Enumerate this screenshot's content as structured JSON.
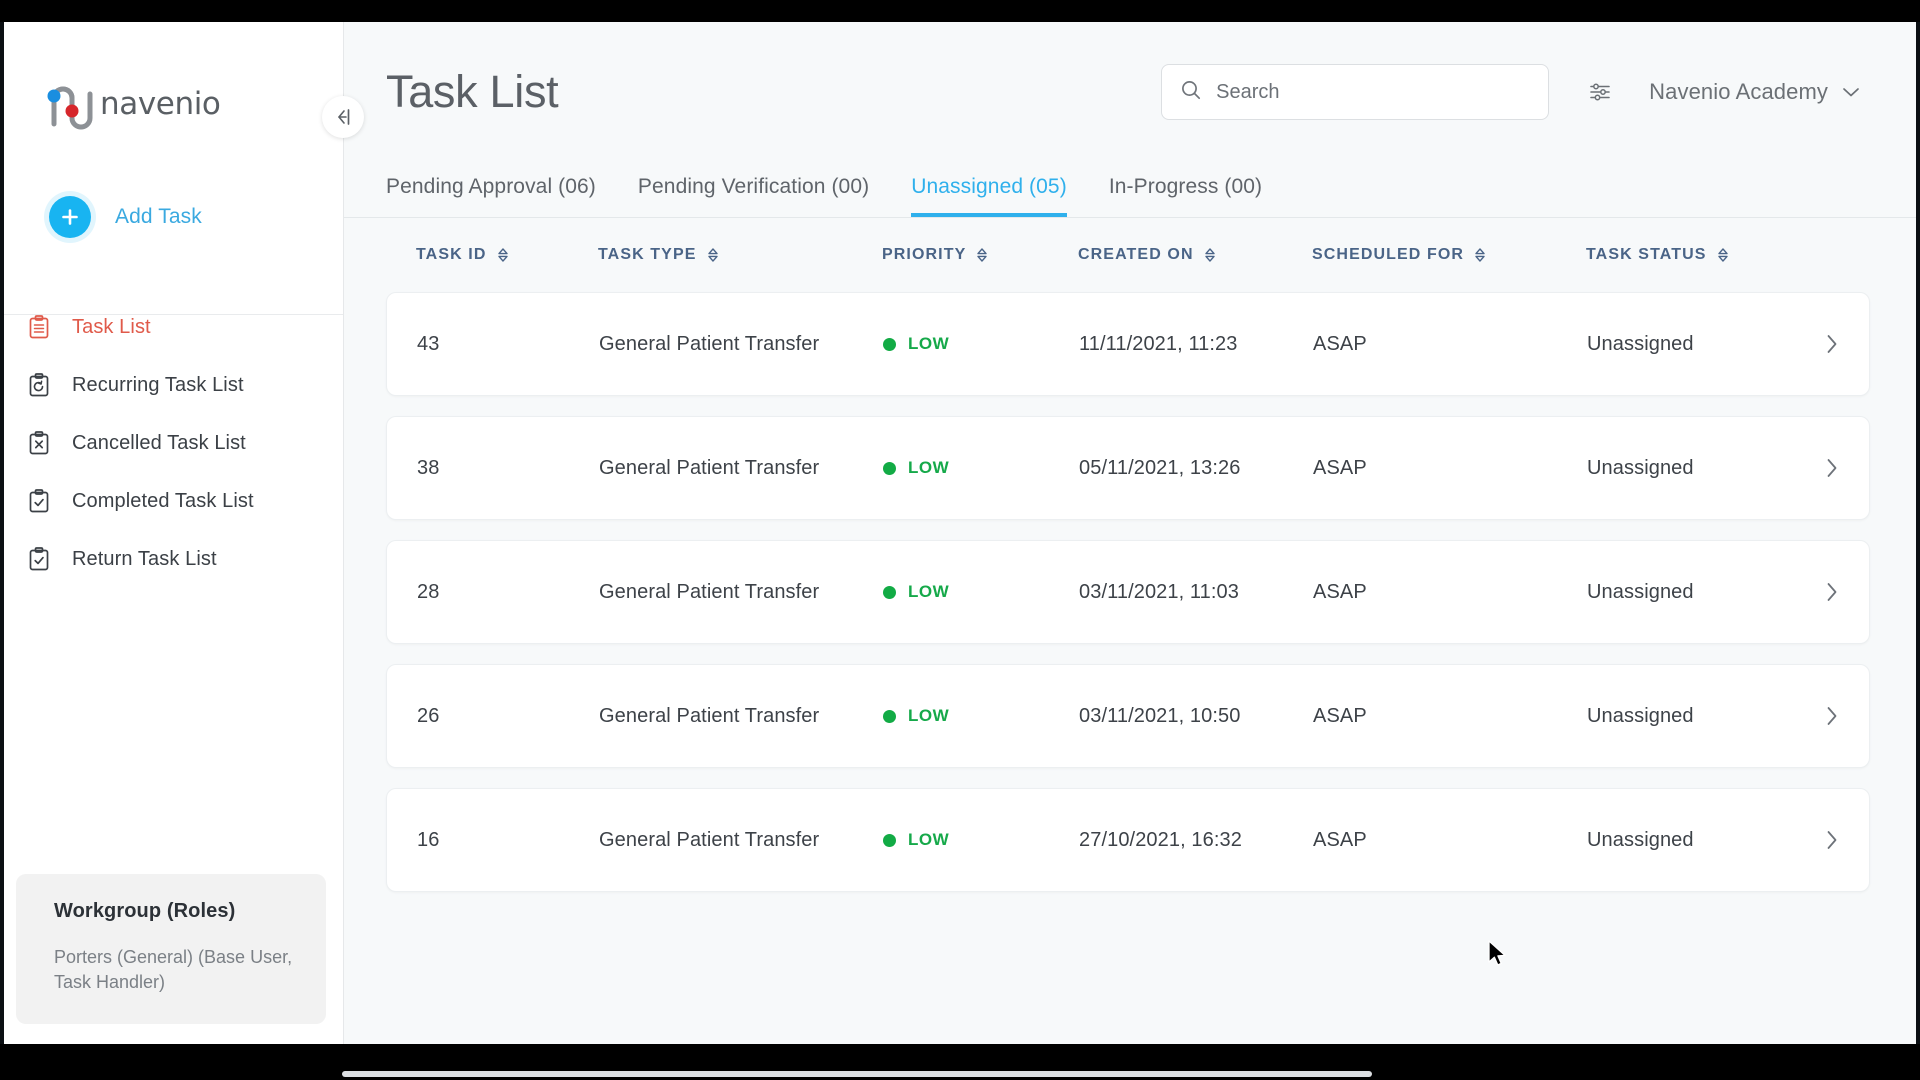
{
  "brand": {
    "name": "navenio",
    "logo_icon": "navenio-logo-icon",
    "dot_blue": "#1a8ee0",
    "dot_red": "#d6262b",
    "stroke": "#8d9196"
  },
  "sidebar": {
    "add_task": {
      "label": "Add Task",
      "icon": "plus-icon",
      "color": "#18b4f1"
    },
    "items": [
      {
        "label": "Task List",
        "icon": "clipboard-list-icon",
        "active": true
      },
      {
        "label": "Recurring Task List",
        "icon": "clipboard-recurring-icon",
        "active": false
      },
      {
        "label": "Cancelled Task List",
        "icon": "clipboard-cancel-icon",
        "active": false
      },
      {
        "label": "Completed Task List",
        "icon": "clipboard-check-icon",
        "active": false
      },
      {
        "label": "Return Task List",
        "icon": "clipboard-return-icon",
        "active": false
      }
    ],
    "active_color": "#e05a4a",
    "workgroup": {
      "title": "Workgroup (Roles)",
      "value": "Porters (General) (Base User, Task Handler)"
    },
    "collapse_icon": "collapse-sidebar-icon"
  },
  "header": {
    "title": "Task List",
    "search": {
      "placeholder": "Search",
      "value": "",
      "icon": "search-icon"
    },
    "filter_icon": "filter-sliders-icon",
    "account": {
      "name": "Navenio Academy",
      "caret_icon": "chevron-down-icon"
    }
  },
  "tabs": [
    {
      "label": "Pending Approval (06)",
      "active": false
    },
    {
      "label": "Pending Verification (00)",
      "active": false
    },
    {
      "label": "Unassigned (05)",
      "active": true
    },
    {
      "label": "In-Progress (00)",
      "active": false
    }
  ],
  "tab_active_color": "#2fb0ec",
  "table": {
    "columns": [
      {
        "label": "TASK ID",
        "sortable": true,
        "sort_icon": "sort-chevrons-icon"
      },
      {
        "label": "TASK TYPE",
        "sortable": true,
        "sort_icon": "sort-chevrons-icon"
      },
      {
        "label": "PRIORITY",
        "sortable": true,
        "sort_icon": "sort-chevrons-icon"
      },
      {
        "label": "CREATED ON",
        "sortable": true,
        "sort_icon": "sort-chevrons-icon"
      },
      {
        "label": "SCHEDULED FOR",
        "sortable": true,
        "sort_icon": "sort-chevrons-icon"
      },
      {
        "label": "TASK STATUS",
        "sortable": true,
        "sort_icon": "sort-chevrons-icon"
      }
    ],
    "row_arrow_icon": "chevron-right-icon",
    "priority_color": "#16a94a",
    "rows": [
      {
        "task_id": "43",
        "task_type": "General Patient Transfer",
        "priority": "LOW",
        "created_on": "11/11/2021, 11:23",
        "scheduled_for": "ASAP",
        "task_status": "Unassigned"
      },
      {
        "task_id": "38",
        "task_type": "General Patient Transfer",
        "priority": "LOW",
        "created_on": "05/11/2021, 13:26",
        "scheduled_for": "ASAP",
        "task_status": "Unassigned"
      },
      {
        "task_id": "28",
        "task_type": "General Patient Transfer",
        "priority": "LOW",
        "created_on": "03/11/2021, 11:03",
        "scheduled_for": "ASAP",
        "task_status": "Unassigned"
      },
      {
        "task_id": "26",
        "task_type": "General Patient Transfer",
        "priority": "LOW",
        "created_on": "03/11/2021, 10:50",
        "scheduled_for": "ASAP",
        "task_status": "Unassigned"
      },
      {
        "task_id": "16",
        "task_type": "General Patient Transfer",
        "priority": "LOW",
        "created_on": "27/10/2021, 16:32",
        "scheduled_for": "ASAP",
        "task_status": "Unassigned"
      }
    ]
  },
  "cursor": {
    "icon": "mouse-pointer-icon"
  }
}
